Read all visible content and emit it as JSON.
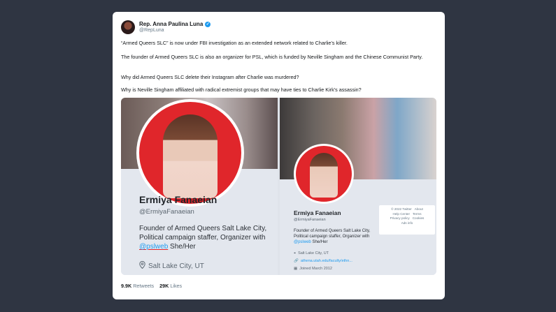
{
  "tweet": {
    "author_name": "Rep. Anna Paulina Luna",
    "author_handle": "@RepLuna",
    "paragraphs": [
      "“Armed Queers SLC” is now under FBI investigation as an extended network related to Charlie’s killer.",
      "The founder of Armed Queers SLC is also an organizer for PSL, which is funded by Neville Singham and the Chinese Communist Party.",
      "Why did Armed Queers SLC delete their Instagram after Charlie was murdered?",
      "Why is Neville Singham affiliated with radical extremist groups that may have ties to Charlie Kirk’s assassin?"
    ],
    "retweets_count": "9.9K",
    "retweets_label": "Retweets",
    "likes_count": "29K",
    "likes_label": "Likes"
  },
  "left_profile": {
    "name": "Ermiya Fanaeian",
    "handle": "@ErmiyaFanaeian",
    "bio_line1": "Founder of Armed Queers Salt Lake City,",
    "bio_line2": "Political campaign staffer, Organizer with",
    "bio_mention": "@pslweb",
    "bio_suffix": " She/Her",
    "location": "Salt Lake City, UT",
    "location_icon": "map-pin-icon"
  },
  "right_profile": {
    "name": "Ermiya Fanaeian",
    "handle": "@ErmiyaFanaeian",
    "bio_line1": "Founder of Armed Queers Salt Lake City,",
    "bio_line2": "Political campaign staffer, Organizer with",
    "bio_mention": "@pslweb",
    "bio_suffix": " She/Her",
    "location": "Salt Lake City, UT",
    "url": "athena.utah.edu/faculty/ethn...",
    "joined": "Joined March 2012",
    "footer": {
      "line1": [
        "© 2022 Twitter",
        "About"
      ],
      "line2": [
        "Help Center",
        "Terms"
      ],
      "line3": [
        "Privacy policy",
        "Cookies"
      ],
      "line4": [
        "Ads info"
      ]
    }
  },
  "colors": {
    "background": "#2f3542",
    "card": "#ffffff",
    "accent": "#1d9bf0",
    "red": "#e0262b"
  }
}
